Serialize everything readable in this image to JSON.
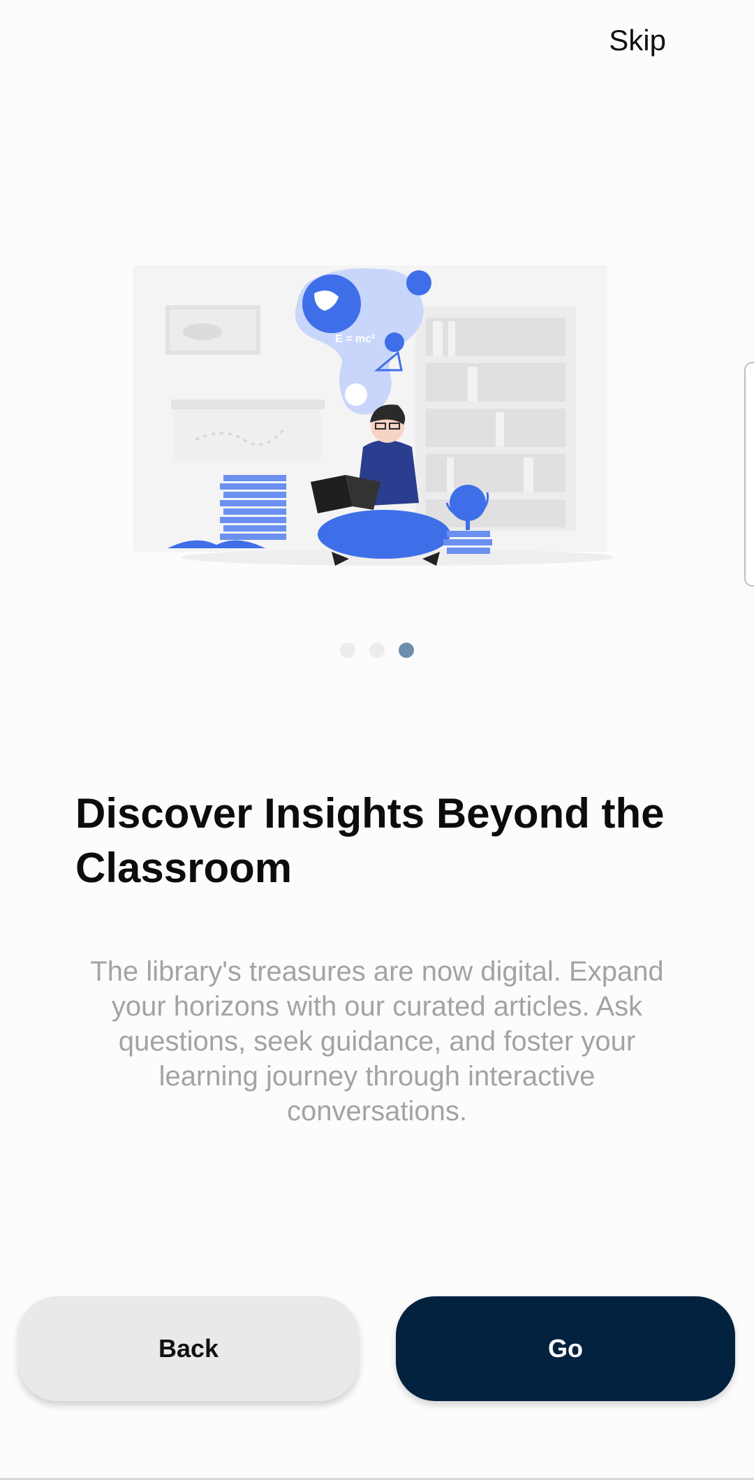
{
  "header": {
    "skip_label": "Skip"
  },
  "slide": {
    "title": "Discover Insights Beyond the Classroom",
    "description": "The library's treasures are now digital. Expand your horizons with our curated articles. Ask questions, seek guidance, and foster your learning journey through interactive conversations.",
    "illustration_icon": "student-reading-illustration",
    "illustration_formula": "E = mc²"
  },
  "pager": {
    "total": 3,
    "current": 3
  },
  "buttons": {
    "back_label": "Back",
    "go_label": "Go"
  },
  "colors": {
    "primary": "#03223f",
    "secondary_button": "#e9e9e9",
    "accent": "#3f6fe8",
    "dot_active": "#6f8eae",
    "dot_inactive": "#ececec",
    "description_text": "#a3a3a3"
  }
}
